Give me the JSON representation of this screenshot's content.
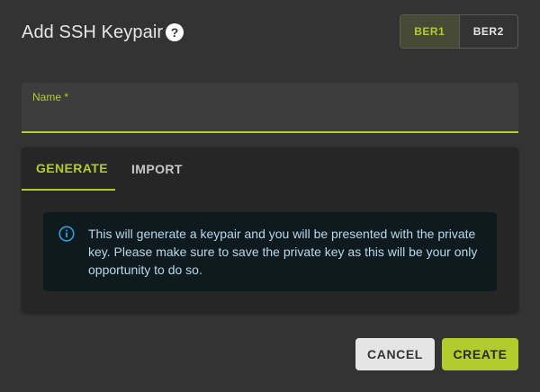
{
  "dialog": {
    "title": "Add SSH Keypair",
    "help_icon": "?"
  },
  "regions": {
    "items": [
      {
        "label": "BER1",
        "active": true
      },
      {
        "label": "BER2",
        "active": false
      }
    ]
  },
  "name_field": {
    "label": "Name *",
    "value": ""
  },
  "tabs": {
    "items": [
      {
        "label": "GENERATE",
        "active": true
      },
      {
        "label": "IMPORT",
        "active": false
      }
    ]
  },
  "info": {
    "icon": "info-icon",
    "text": "This will generate a keypair and you will be presented with the private key. Please make sure to save the private key as this will be your only opportunity to do so."
  },
  "actions": {
    "cancel_label": "CANCEL",
    "create_label": "CREATE"
  },
  "colors": {
    "accent": "#b2cc2d",
    "background": "#333333",
    "info_bg": "#0e1a1e",
    "info_text": "#b8d8ec"
  }
}
